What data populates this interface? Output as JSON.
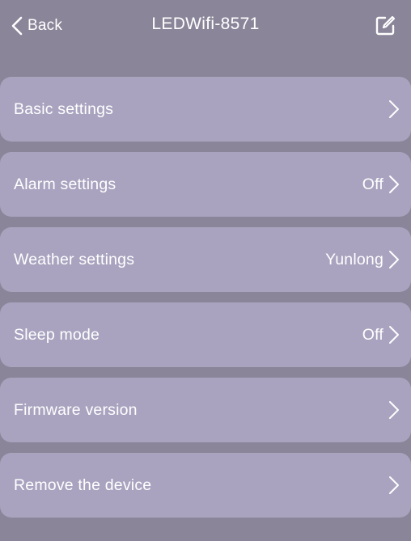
{
  "header": {
    "back_label": "Back",
    "title": "LEDWifi-8571",
    "back_icon": "chevron-left-icon",
    "edit_icon": "edit-icon"
  },
  "colors": {
    "background": "#8b8599",
    "row_background": "#a9a3bf",
    "text": "#ffffff"
  },
  "settings": [
    {
      "label": "Basic settings",
      "value": ""
    },
    {
      "label": "Alarm settings",
      "value": "Off"
    },
    {
      "label": "Weather settings",
      "value": "Yunlong"
    },
    {
      "label": "Sleep mode",
      "value": "Off"
    },
    {
      "label": "Firmware version",
      "value": ""
    },
    {
      "label": "Remove the device",
      "value": ""
    }
  ]
}
